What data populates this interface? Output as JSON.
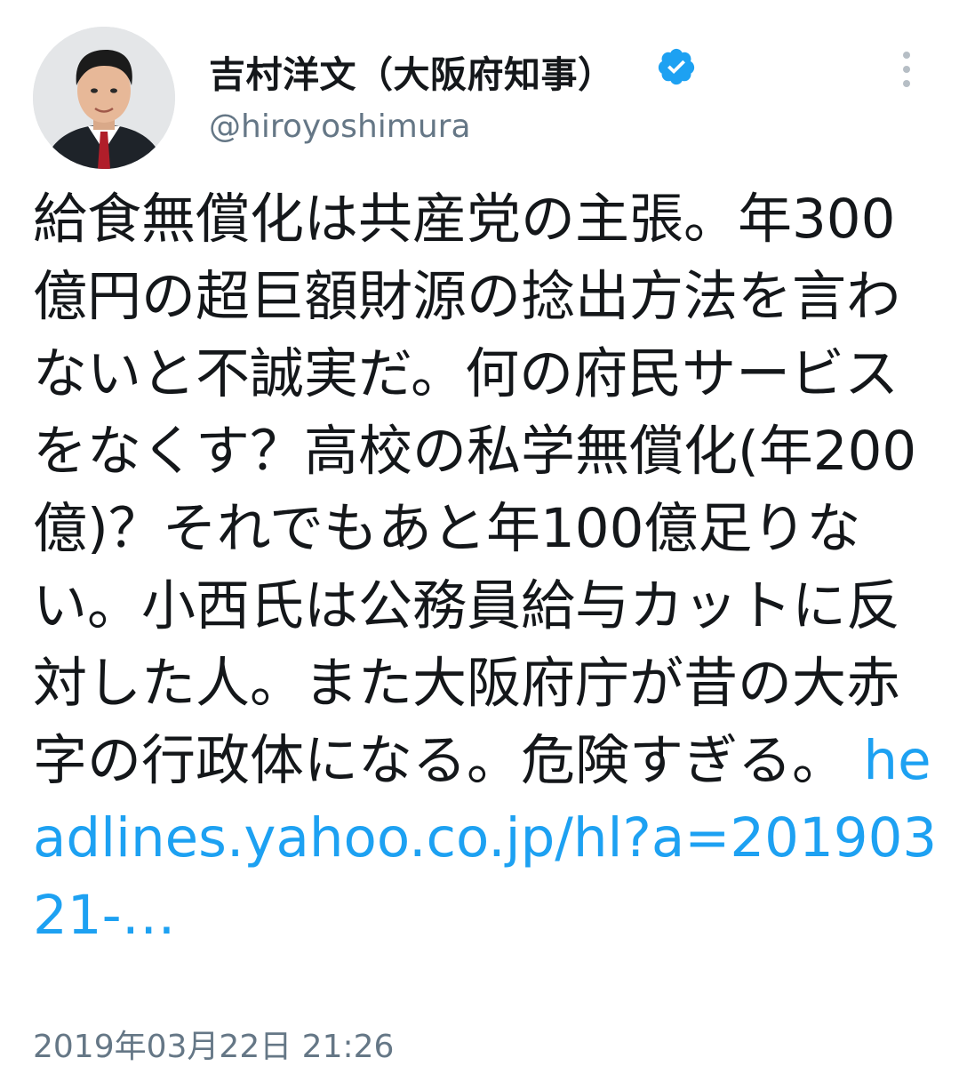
{
  "tweet": {
    "author": {
      "display_name": "吉村洋文（大阪府知事）",
      "handle": "@hiroyoshimura",
      "verified_icon": "verified-badge-icon",
      "verified_color": "#1da1f2"
    },
    "menu_icon": "more-options-icon",
    "text": "給食無償化は共産党の主張。年300億円の超巨額財源の捻出方法を言わないと不誠実だ。何の府民サービスをなくす？高校の私学無償化(年200億)？それでもあと年100億足りない。小西氏は公務員給与カットに反対した人。また大阪府庁が昔の大赤字の行政体になる。危険すぎる。",
    "link_text": "headlines.yahoo.co.jp/hl?a=20190321-…",
    "link_color": "#1da1f2",
    "timestamp": "2019年03月22日 21:26"
  }
}
